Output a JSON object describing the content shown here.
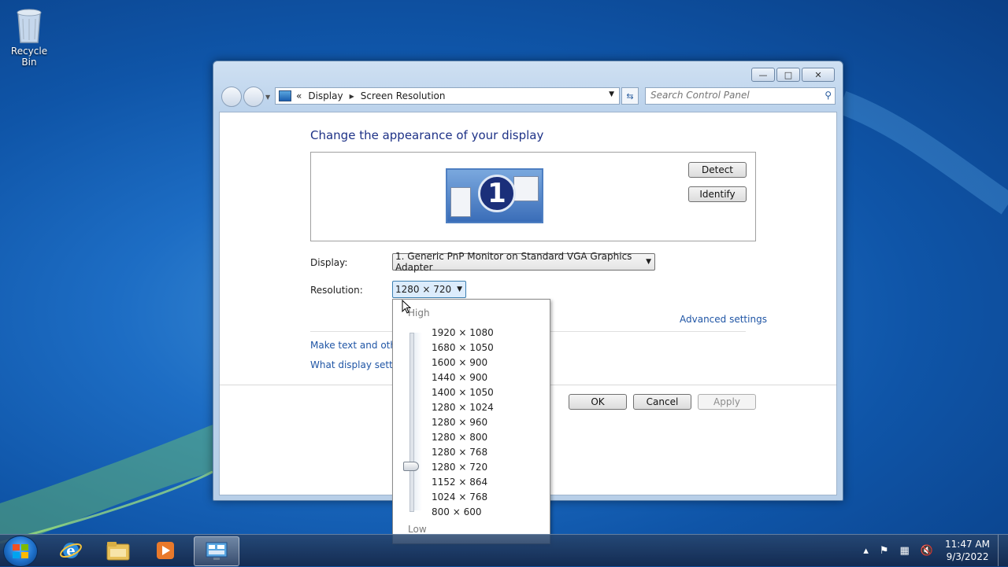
{
  "desktop": {
    "icons": [
      {
        "label": "Recycle Bin",
        "icon": "recycle-bin-icon"
      }
    ]
  },
  "window": {
    "controls": {
      "minimize": "—",
      "maximize": "□",
      "close": "✕"
    },
    "address": {
      "overflow": "«",
      "crumbs": [
        "Display",
        "Screen Resolution"
      ]
    },
    "search_placeholder": "Search Control Panel",
    "heading": "Change the appearance of your display",
    "detect_label": "Detect",
    "identify_label": "Identify",
    "monitor_number": "1",
    "display_label": "Display:",
    "display_value": "1. Generic PnP Monitor on Standard VGA Graphics Adapter",
    "resolution_label": "Resolution:",
    "resolution_value": "1280 × 720",
    "advanced_link": "Advanced settings",
    "link1": "Make text and other",
    "link2": "What display setting",
    "ok_label": "OK",
    "cancel_label": "Cancel",
    "apply_label": "Apply"
  },
  "resolution_popup": {
    "high_label": "High",
    "low_label": "Low",
    "options": [
      "1920 × 1080",
      "1680 × 1050",
      "1600 × 900",
      "1440 × 900",
      "1400 × 1050",
      "1280 × 1024",
      "1280 × 960",
      "1280 × 800",
      "1280 × 768",
      "1280 × 720",
      "1152 × 864",
      "1024 × 768",
      "800 × 600"
    ],
    "selected": "1280 × 720"
  },
  "taskbar": {
    "apps": [
      {
        "name": "internet-explorer-icon",
        "active": false
      },
      {
        "name": "file-explorer-icon",
        "active": false
      },
      {
        "name": "media-player-icon",
        "active": false
      },
      {
        "name": "control-panel-icon",
        "active": true
      }
    ],
    "tray": {
      "show_hidden": "▴",
      "time": "11:47 AM",
      "date": "9/3/2022"
    }
  },
  "colors": {
    "heading": "#1e3287",
    "link": "#1f55a5",
    "accent": "#3c7fb1"
  }
}
